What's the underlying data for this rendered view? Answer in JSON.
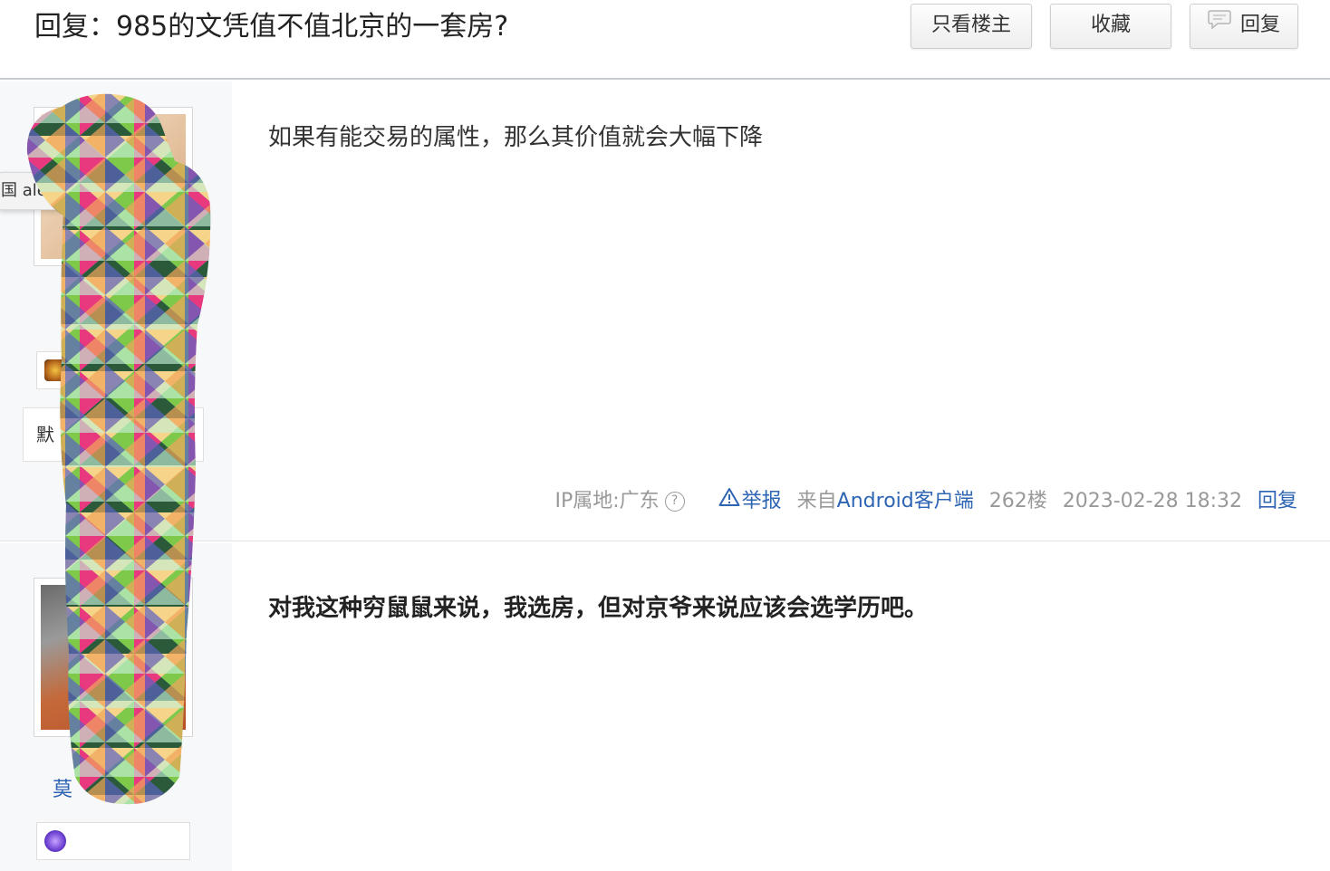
{
  "header": {
    "thread_title": "回复：985的文凭值不值北京的一套房?",
    "buttons": {
      "only_op": "只看楼主",
      "favorite": "收藏",
      "reply": "回复"
    }
  },
  "posts": [
    {
      "content": "如果有能交易的属性，那么其价值就会大幅下降",
      "nickname_partial": "默",
      "tail": {
        "ip_location": "IP属地:广东",
        "report": "举报",
        "from_prefix": "来自",
        "client": "Android客户端",
        "floor": "262楼",
        "time": "2023-02-28 18:32",
        "reply": "回复"
      }
    },
    {
      "content": "对我这种穷鼠鼠来说，我选房，但对京爷来说应该会选学历吧。",
      "username_partial": "莫"
    }
  ],
  "tooltip_text": "国 ale",
  "icons": {
    "reply_button_icon": "speech-bubble-icon",
    "report_icon": "warning-triangle-icon",
    "help_icon": "question-circle-icon"
  },
  "colors": {
    "link_blue": "#2d64b3",
    "meta_gray": "#999999",
    "sidebar_bg": "#f7f8fa"
  }
}
